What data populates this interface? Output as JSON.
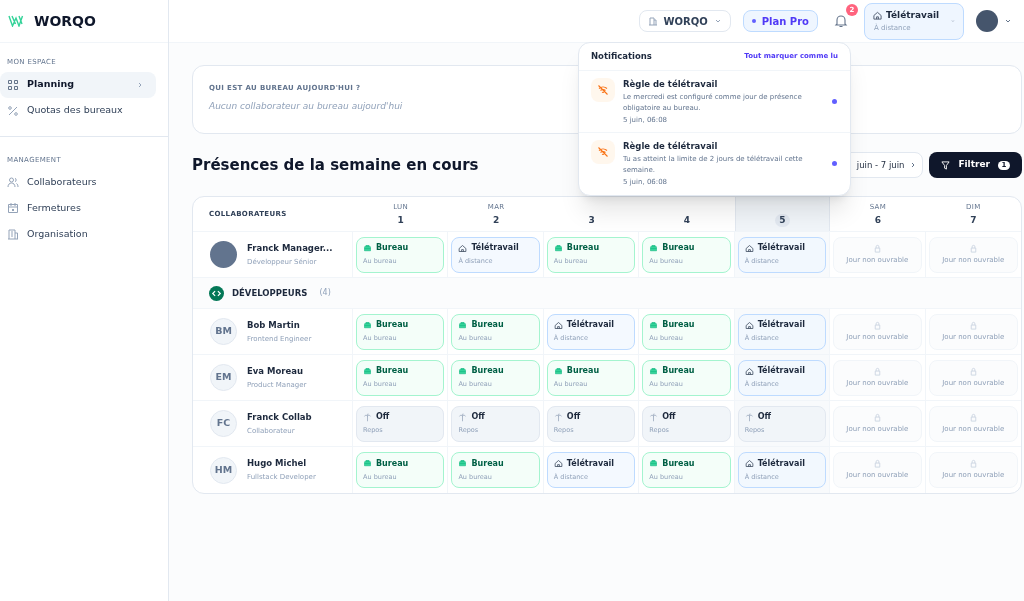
{
  "brand": "WORQO",
  "sidebar": {
    "sections": [
      {
        "title": "MON ESPACE",
        "items": [
          {
            "label": "Planning",
            "selected": true
          },
          {
            "label": "Quotas des bureaux",
            "selected": false
          }
        ]
      },
      {
        "title": "MANAGEMENT",
        "items": [
          {
            "label": "Collaborateurs",
            "selected": false
          },
          {
            "label": "Fermetures",
            "selected": false
          },
          {
            "label": "Organisation",
            "selected": false
          }
        ]
      }
    ]
  },
  "topbar": {
    "org": "WORQO",
    "plan": "Plan Pro",
    "notification_count": "2",
    "status": {
      "label": "Télétravail",
      "sub": "À distance"
    }
  },
  "notifications": {
    "title": "Notifications",
    "action": "Tout marquer comme lu",
    "items": [
      {
        "title": "Règle de télétravail",
        "body": "Le mercredi est configuré comme jour de présence obligatoire au bureau.",
        "time": "5 juin, 06:08",
        "unread": true
      },
      {
        "title": "Règle de télétravail",
        "body": "Tu as atteint la limite de 2 jours de télétravail cette semaine.",
        "time": "5 juin, 06:08",
        "unread": true
      }
    ]
  },
  "today_card": {
    "title": "QUI EST AU BUREAU AUJOURD'HUI ?",
    "empty": "Aucun collaborateur au bureau aujourd'hui"
  },
  "week": {
    "title": "Présences de la semaine en cours",
    "range": "juin - 7 juin",
    "filter": "Filtrer",
    "filter_count": "1"
  },
  "table": {
    "column_header": "COLLABORATEURS",
    "days": [
      {
        "name": "LUN",
        "number": "1",
        "today": false
      },
      {
        "name": "MAR",
        "number": "2",
        "today": false
      },
      {
        "number": "3",
        "today": false
      },
      {
        "number": "4",
        "today": false
      },
      {
        "number": "5",
        "today": true
      },
      {
        "name": "SAM",
        "number": "6",
        "today": false
      },
      {
        "name": "DIM",
        "number": "7",
        "today": false
      }
    ],
    "rows": [
      {
        "kind": "member",
        "name": "Franck Manager...",
        "role": "Développeur Sénior",
        "cells": [
          {
            "kind": "bureau",
            "label": "Bureau",
            "sub": "Au bureau"
          },
          {
            "kind": "teletravail",
            "label": "Télétravail",
            "sub": "À distance"
          },
          {
            "kind": "bureau",
            "label": "Bureau",
            "sub": "Au bureau"
          },
          {
            "kind": "bureau",
            "label": "Bureau",
            "sub": "Au bureau"
          },
          {
            "kind": "teletravail",
            "label": "Télétravail",
            "sub": "À distance"
          },
          {
            "kind": "closed",
            "sub": "Jour non ouvrable"
          },
          {
            "kind": "closed",
            "sub": "Jour non ouvrable"
          }
        ]
      },
      {
        "kind": "group",
        "name": "DÉVELOPPEURS",
        "count": "(4)"
      },
      {
        "kind": "member",
        "initials": "BM",
        "name": "Bob Martin",
        "role": "Frontend Engineer",
        "cells": [
          {
            "kind": "bureau",
            "label": "Bureau",
            "sub": "Au bureau"
          },
          {
            "kind": "bureau",
            "label": "Bureau",
            "sub": "Au bureau"
          },
          {
            "kind": "teletravail",
            "label": "Télétravail",
            "sub": "À distance"
          },
          {
            "kind": "bureau",
            "label": "Bureau",
            "sub": "Au bureau"
          },
          {
            "kind": "teletravail",
            "label": "Télétravail",
            "sub": "À distance"
          },
          {
            "kind": "closed",
            "sub": "Jour non ouvrable"
          },
          {
            "kind": "closed",
            "sub": "Jour non ouvrable"
          }
        ]
      },
      {
        "kind": "member",
        "initials": "EM",
        "name": "Eva Moreau",
        "role": "Product Manager",
        "cells": [
          {
            "kind": "bureau",
            "label": "Bureau",
            "sub": "Au bureau"
          },
          {
            "kind": "bureau",
            "label": "Bureau",
            "sub": "Au bureau"
          },
          {
            "kind": "bureau",
            "label": "Bureau",
            "sub": "Au bureau"
          },
          {
            "kind": "bureau",
            "label": "Bureau",
            "sub": "Au bureau"
          },
          {
            "kind": "teletravail",
            "label": "Télétravail",
            "sub": "À distance"
          },
          {
            "kind": "closed",
            "sub": "Jour non ouvrable"
          },
          {
            "kind": "closed",
            "sub": "Jour non ouvrable"
          }
        ]
      },
      {
        "kind": "member",
        "initials": "FC",
        "name": "Franck Collab",
        "role": "Collaborateur",
        "cells": [
          {
            "kind": "off",
            "label": "Off",
            "sub": "Repos"
          },
          {
            "kind": "off",
            "label": "Off",
            "sub": "Repos"
          },
          {
            "kind": "off",
            "label": "Off",
            "sub": "Repos"
          },
          {
            "kind": "off",
            "label": "Off",
            "sub": "Repos"
          },
          {
            "kind": "off",
            "label": "Off",
            "sub": "Repos"
          },
          {
            "kind": "closed",
            "sub": "Jour non ouvrable"
          },
          {
            "kind": "closed",
            "sub": "Jour non ouvrable"
          }
        ]
      },
      {
        "kind": "member",
        "initials": "HM",
        "name": "Hugo Michel",
        "role": "Fullstack Developer",
        "cells": [
          {
            "kind": "bureau",
            "label": "Bureau",
            "sub": "Au bureau"
          },
          {
            "kind": "bureau",
            "label": "Bureau",
            "sub": "Au bureau"
          },
          {
            "kind": "teletravail",
            "label": "Télétravail",
            "sub": "À distance"
          },
          {
            "kind": "bureau",
            "label": "Bureau",
            "sub": "Au bureau"
          },
          {
            "kind": "teletravail",
            "label": "Télétravail",
            "sub": "À distance"
          },
          {
            "kind": "closed",
            "sub": "Jour non ouvrable"
          },
          {
            "kind": "closed",
            "sub": "Jour non ouvrable"
          }
        ]
      }
    ]
  }
}
